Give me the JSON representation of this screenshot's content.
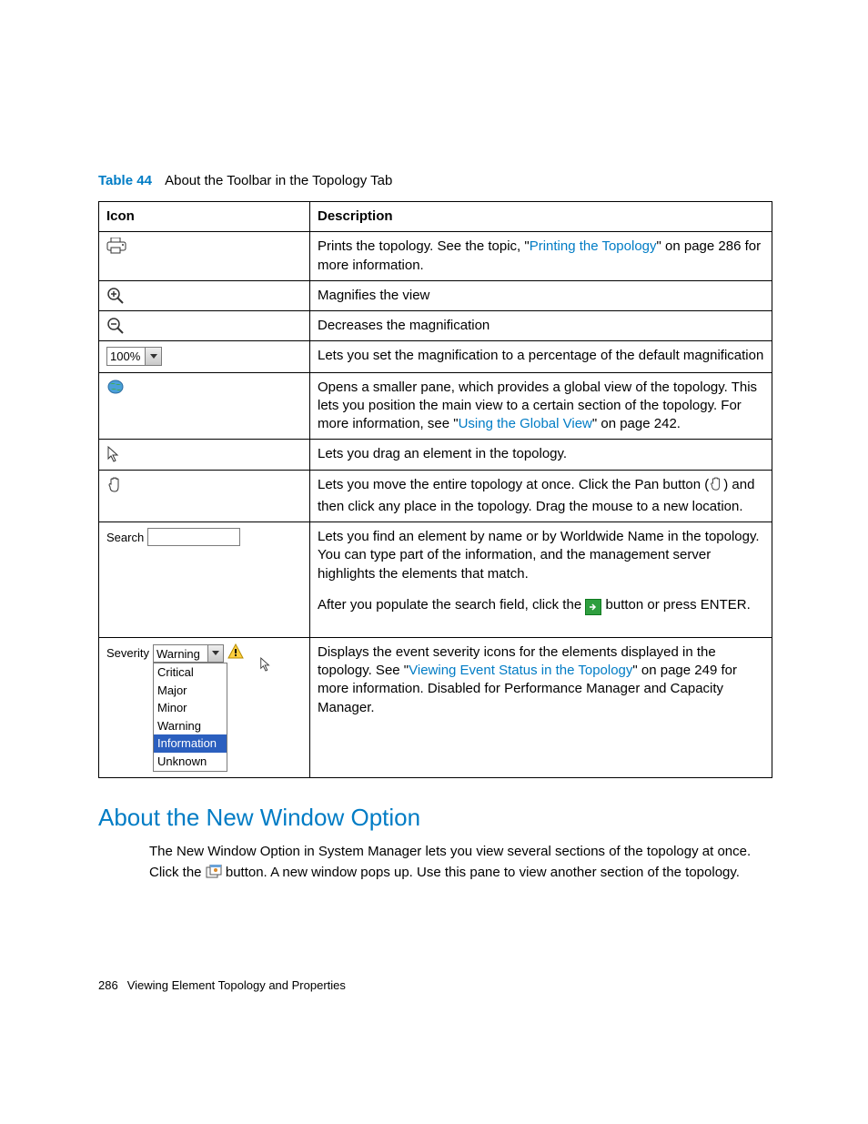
{
  "caption": {
    "label": "Table 44",
    "title": "About the Toolbar in the Topology Tab"
  },
  "headers": {
    "icon": "Icon",
    "desc": "Description"
  },
  "rows": {
    "print": {
      "t1": "Prints the topology. See the topic, \"",
      "link": "Printing the Topology",
      "t2": "\" on page 286 for more information."
    },
    "zoomin": "Magnifies the view",
    "zoomout": "Decreases the magnification",
    "zoompct": {
      "value": "100%",
      "desc": "Lets you set the magnification to a percentage of the default magnification"
    },
    "globe": {
      "t1": "Opens a smaller pane, which provides a global view of the topology. This lets you position the main view to a certain section of the topology. For more information, see \"",
      "link": "Using the Global View",
      "t2": "\" on page 242."
    },
    "drag": "Lets you drag an element in the topology.",
    "pan": {
      "t1": "Lets you move the entire topology at once. Click the Pan button (",
      "t2": ") and then click any place in the topology. Drag the mouse to a new location."
    },
    "search": {
      "label": "Search",
      "p1": "Lets you find an element by name or by Worldwide Name in the topology. You can type part of the information, and the management server highlights the elements that match.",
      "p2a": "After you populate the search field, click the ",
      "p2b": " button or press ",
      "p2c": "ENTER",
      "p2d": "."
    },
    "severity": {
      "label": "Severity",
      "selected": "Warning",
      "opts": [
        "Critical",
        "Major",
        "Minor",
        "Warning",
        "Information",
        "Unknown"
      ],
      "t1": "Displays the event severity icons for the elements displayed in the topology. See \"",
      "link": "Viewing Event Status in the Topology",
      "t2": "\" on page 249 for more information. Disabled for Performance Manager and Capacity Manager."
    }
  },
  "section": {
    "heading": "About the New Window Option",
    "p1a": "The New Window Option in System Manager lets you view several sections of the topology at once. Click the ",
    "p1b": " button. A new window pops up. Use this pane to view another section of the topology."
  },
  "footer": {
    "page": "286",
    "chapter": "Viewing Element Topology and Properties"
  }
}
